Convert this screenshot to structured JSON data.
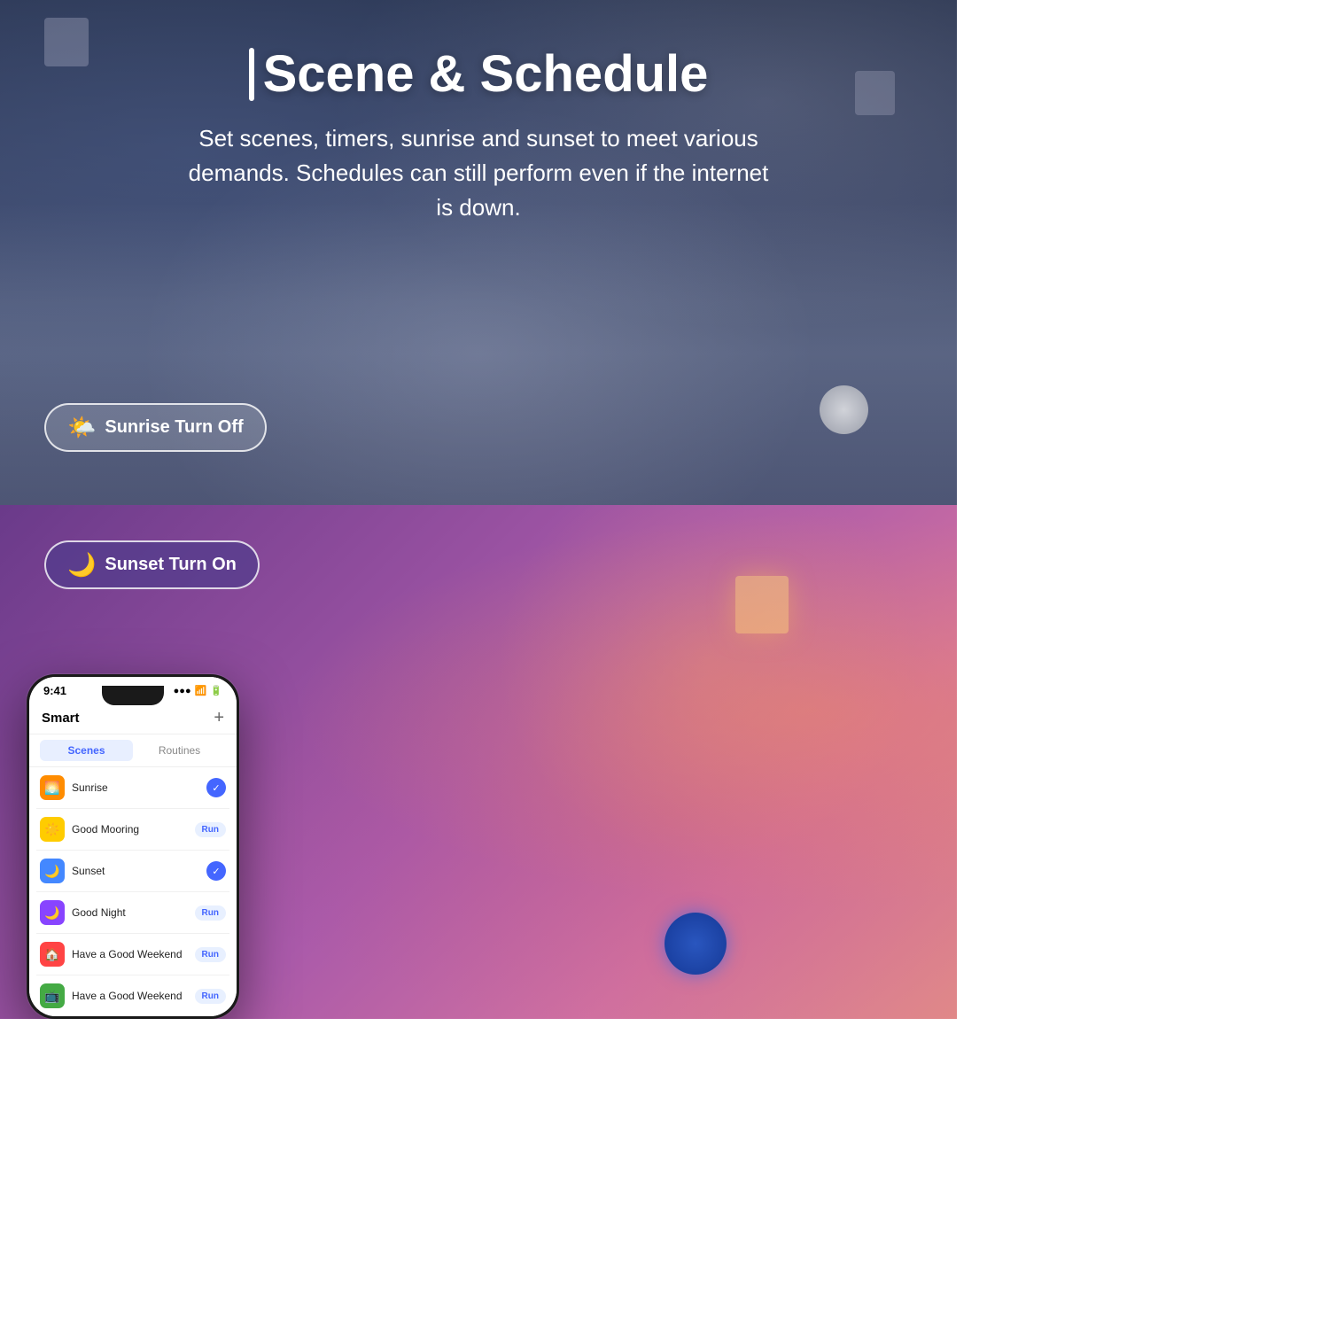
{
  "top": {
    "accent": "|",
    "title": "Scene & Schedule",
    "subtitle": "Set scenes, timers, sunrise and sunset to meet various demands. Schedules can still perform even if the internet is down.",
    "sunrise_badge": "Sunrise Turn Off",
    "sunrise_icon": "🌤️"
  },
  "bottom": {
    "sunset_badge": "Sunset Turn On",
    "sunset_icon": "🌙"
  },
  "phone": {
    "time": "9:41",
    "signal": "●●●",
    "wifi": "WiFi",
    "battery": "▮▮▮",
    "header_title": "Smart",
    "header_plus": "+",
    "tab_scenes": "Scenes",
    "tab_routines": "Routines",
    "items": [
      {
        "name": "Sunrise",
        "icon": "🌅",
        "icon_class": "orange",
        "badge_type": "check"
      },
      {
        "name": "Good Mooring",
        "icon": "☀️",
        "icon_class": "yellow",
        "badge_type": "run",
        "badge_label": "Run"
      },
      {
        "name": "Sunset",
        "icon": "🌙",
        "icon_class": "blue",
        "badge_type": "check"
      },
      {
        "name": "Good Night",
        "icon": "🌙",
        "icon_class": "purple",
        "badge_type": "run",
        "badge_label": "Run"
      },
      {
        "name": "Have a Good Weekend",
        "icon": "🏠",
        "icon_class": "red",
        "badge_type": "run",
        "badge_label": "Run"
      },
      {
        "name": "Have a Good Weekend",
        "icon": "📺",
        "icon_class": "green",
        "badge_type": "run",
        "badge_label": "Run"
      }
    ]
  }
}
